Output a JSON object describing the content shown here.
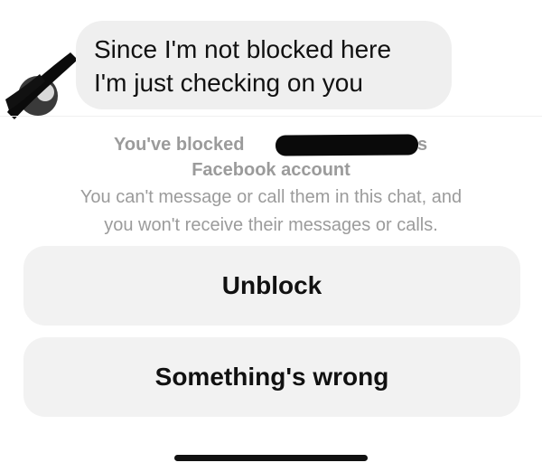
{
  "message": {
    "lines": [
      "Since I'm not blocked here",
      "I'm just checking on you"
    ]
  },
  "notice": {
    "title_prefix": "You've blocked",
    "title_suffix": "s",
    "title_line2": "Facebook account",
    "description_line1": "You can't message or call them in this chat, and",
    "description_line2": "you won't receive their messages or calls."
  },
  "actions": {
    "unblock_label": "Unblock",
    "wrong_label": "Something's wrong"
  },
  "colors": {
    "bubble": "#efefef",
    "button": "#f2f2f2",
    "muted_text": "#9b9b9b",
    "redaction": "#0a0a0a"
  }
}
